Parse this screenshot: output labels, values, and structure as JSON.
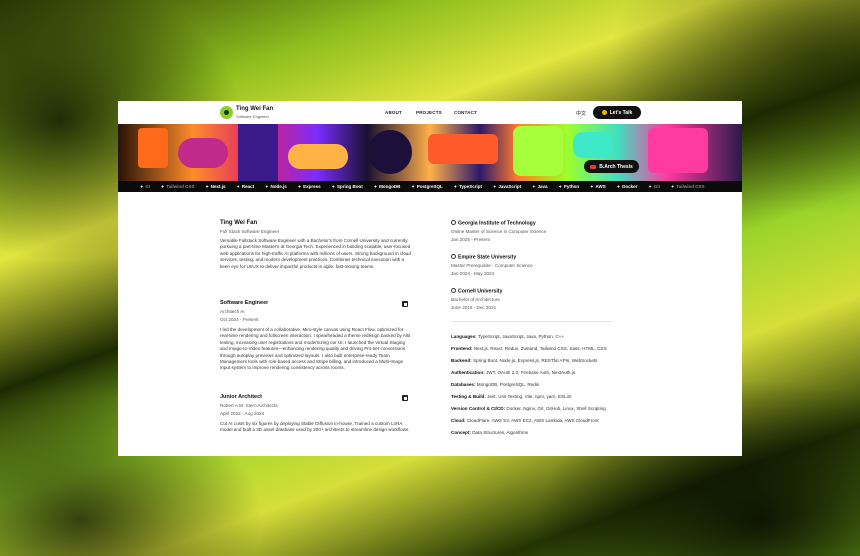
{
  "header": {
    "name": "Ting Wei Fan",
    "role": "Software Engineer",
    "nav": [
      "ABOUT",
      "PROJECTS",
      "CONTACT"
    ],
    "lang": "中文",
    "cta": "Let's Talk"
  },
  "hero": {
    "badge": "B.Arch Thesis"
  },
  "tech_strip": [
    "CI",
    "Tailwind CSS",
    "Next.js",
    "React",
    "Node.js",
    "Express",
    "Spring Boot",
    "MongoDB",
    "PostgreSQL",
    "TypeScript",
    "JavaScript",
    "Java",
    "Python",
    "AWS",
    "Docker",
    "Git",
    "Tailwind CSS"
  ],
  "profile": {
    "name": "Ting Wei Fan",
    "title": "Full Stack Software Engineer",
    "bio": "Versatile Fullstack Software Engineer with a Bachelor's from Cornell University and currently pursuing a part-time Master's at Georgia Tech. Experienced in building scalable, user-focused web applications for high-traffic AI platforms with millions of users. Strong background in cloud services, testing, and modern development practices. Combines technical execution with a keen eye for UI/UX to deliver impactful products in agile, fast-moving teams."
  },
  "experience": [
    {
      "role": "Software Engineer",
      "company": "Architech AI",
      "dates": "Oct 2024 - Present",
      "desc": "I led the development of a collaborative, Miro-style canvas using React Flow, optimized for real-time rendering and fullscreen interaction. I spearheaded a theme redesign backed by A/B testing, increasing user registrations and modernizing our UI. I launched the Virtual Staging and Image-to-Video features—enhancing rendering quality and driving Pro-tier conversions through autoplay previews and optimized layouts. I also built enterprise-ready Team Management tools with role-based access and Stripe billing, and introduced a Multi-Image Input system to improve rendering consistency across rooms."
    },
    {
      "role": "Junior Architect",
      "company": "Robert A.M. Stern Architects",
      "dates": "April 2022 - Aug 2024",
      "desc": "Cut AI costs by six figures by deploying Stable Diffusion in-house. Trained a custom LoRA model and built a 3D asset database used by 200+ architects to streamline design workflows."
    }
  ],
  "education": [
    {
      "school": "Georgia Institute of Technology",
      "degree": "Online Master of Science in Computer Science",
      "dates": "Jan 2025 - Present"
    },
    {
      "school": "Empire State University",
      "degree": "Master Prerequisite - Computer Science",
      "dates": "Jan 2024 - May 2024"
    },
    {
      "school": "Cornell University",
      "degree": "Bachelor of Architecture",
      "dates": "June 2016 - Dec 2021"
    }
  ],
  "skills": [
    {
      "label": "Languages:",
      "value": "TypeScript, JavaScript, Java, Python, C++"
    },
    {
      "label": "Frontend:",
      "value": "Next.js, React, Redux, Zustand, Tailwind CSS, Sass, HTML, CSS"
    },
    {
      "label": "Backend:",
      "value": "Spring Boot, Node.js, Express.js, RESTful APIs, WebSockets"
    },
    {
      "label": "Authentication:",
      "value": "JWT, OAuth 2.0, Firebase Auth, NextAuth.js"
    },
    {
      "label": "Databases:",
      "value": "MongoDB, PostgreSQL, Redis"
    },
    {
      "label": "Testing & Build:",
      "value": "Jest, Unit Testing, Vite, npm, yarn, ESLint"
    },
    {
      "label": "Version Control & CI/CD:",
      "value": "Docker, Nginx, Git, GitHub, Linux, Shell Scripting"
    },
    {
      "label": "Cloud:",
      "value": "CloudFlare, AWS S3, AWS EC2, AWS Lambda, AWS CloudFront"
    },
    {
      "label": "Concept:",
      "value": "Data Structures, Algorithms"
    }
  ]
}
